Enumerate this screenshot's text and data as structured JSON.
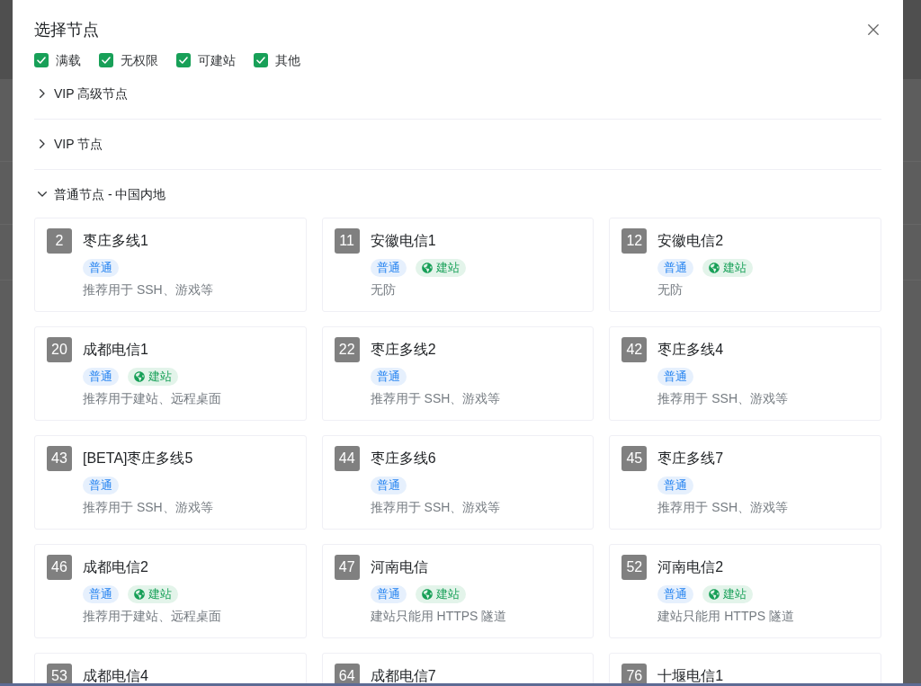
{
  "dialog": {
    "title": "选择节点",
    "filters": [
      {
        "label": "满载",
        "checked": true
      },
      {
        "label": "无权限",
        "checked": true
      },
      {
        "label": "可建站",
        "checked": true
      },
      {
        "label": "其他",
        "checked": true
      }
    ],
    "groups": [
      {
        "title": "VIP 高级节点",
        "expanded": false
      },
      {
        "title": "VIP 节点",
        "expanded": false
      },
      {
        "title": "普通节点 - 中国内地",
        "expanded": true,
        "nodes": [
          {
            "id": "2",
            "name": "枣庄多线1",
            "tags": [
              {
                "label": "普通",
                "kind": "normal"
              }
            ],
            "note": "推荐用于 SSH、游戏等"
          },
          {
            "id": "11",
            "name": "安徽电信1",
            "tags": [
              {
                "label": "普通",
                "kind": "normal"
              },
              {
                "label": "建站",
                "kind": "site"
              }
            ],
            "note": "无防"
          },
          {
            "id": "12",
            "name": "安徽电信2",
            "tags": [
              {
                "label": "普通",
                "kind": "normal"
              },
              {
                "label": "建站",
                "kind": "site"
              }
            ],
            "note": "无防"
          },
          {
            "id": "20",
            "name": "成都电信1",
            "tags": [
              {
                "label": "普通",
                "kind": "normal"
              },
              {
                "label": "建站",
                "kind": "site"
              }
            ],
            "note": "推荐用于建站、远程桌面"
          },
          {
            "id": "22",
            "name": "枣庄多线2",
            "tags": [
              {
                "label": "普通",
                "kind": "normal"
              }
            ],
            "note": "推荐用于 SSH、游戏等"
          },
          {
            "id": "42",
            "name": "枣庄多线4",
            "tags": [
              {
                "label": "普通",
                "kind": "normal"
              }
            ],
            "note": "推荐用于 SSH、游戏等"
          },
          {
            "id": "43",
            "name": "[BETA]枣庄多线5",
            "tags": [
              {
                "label": "普通",
                "kind": "normal"
              }
            ],
            "note": "推荐用于 SSH、游戏等"
          },
          {
            "id": "44",
            "name": "枣庄多线6",
            "tags": [
              {
                "label": "普通",
                "kind": "normal"
              }
            ],
            "note": "推荐用于 SSH、游戏等"
          },
          {
            "id": "45",
            "name": "枣庄多线7",
            "tags": [
              {
                "label": "普通",
                "kind": "normal"
              }
            ],
            "note": "推荐用于 SSH、游戏等"
          },
          {
            "id": "46",
            "name": "成都电信2",
            "tags": [
              {
                "label": "普通",
                "kind": "normal"
              },
              {
                "label": "建站",
                "kind": "site"
              }
            ],
            "note": "推荐用于建站、远程桌面"
          },
          {
            "id": "47",
            "name": "河南电信",
            "tags": [
              {
                "label": "普通",
                "kind": "normal"
              },
              {
                "label": "建站",
                "kind": "site"
              }
            ],
            "note": "建站只能用 HTTPS 隧道"
          },
          {
            "id": "52",
            "name": "河南电信2",
            "tags": [
              {
                "label": "普通",
                "kind": "normal"
              },
              {
                "label": "建站",
                "kind": "site"
              }
            ],
            "note": "建站只能用 HTTPS 隧道"
          },
          {
            "id": "53",
            "name": "成都电信4"
          },
          {
            "id": "64",
            "name": "成都电信7"
          },
          {
            "id": "76",
            "name": "十堰电信1"
          }
        ]
      }
    ]
  }
}
